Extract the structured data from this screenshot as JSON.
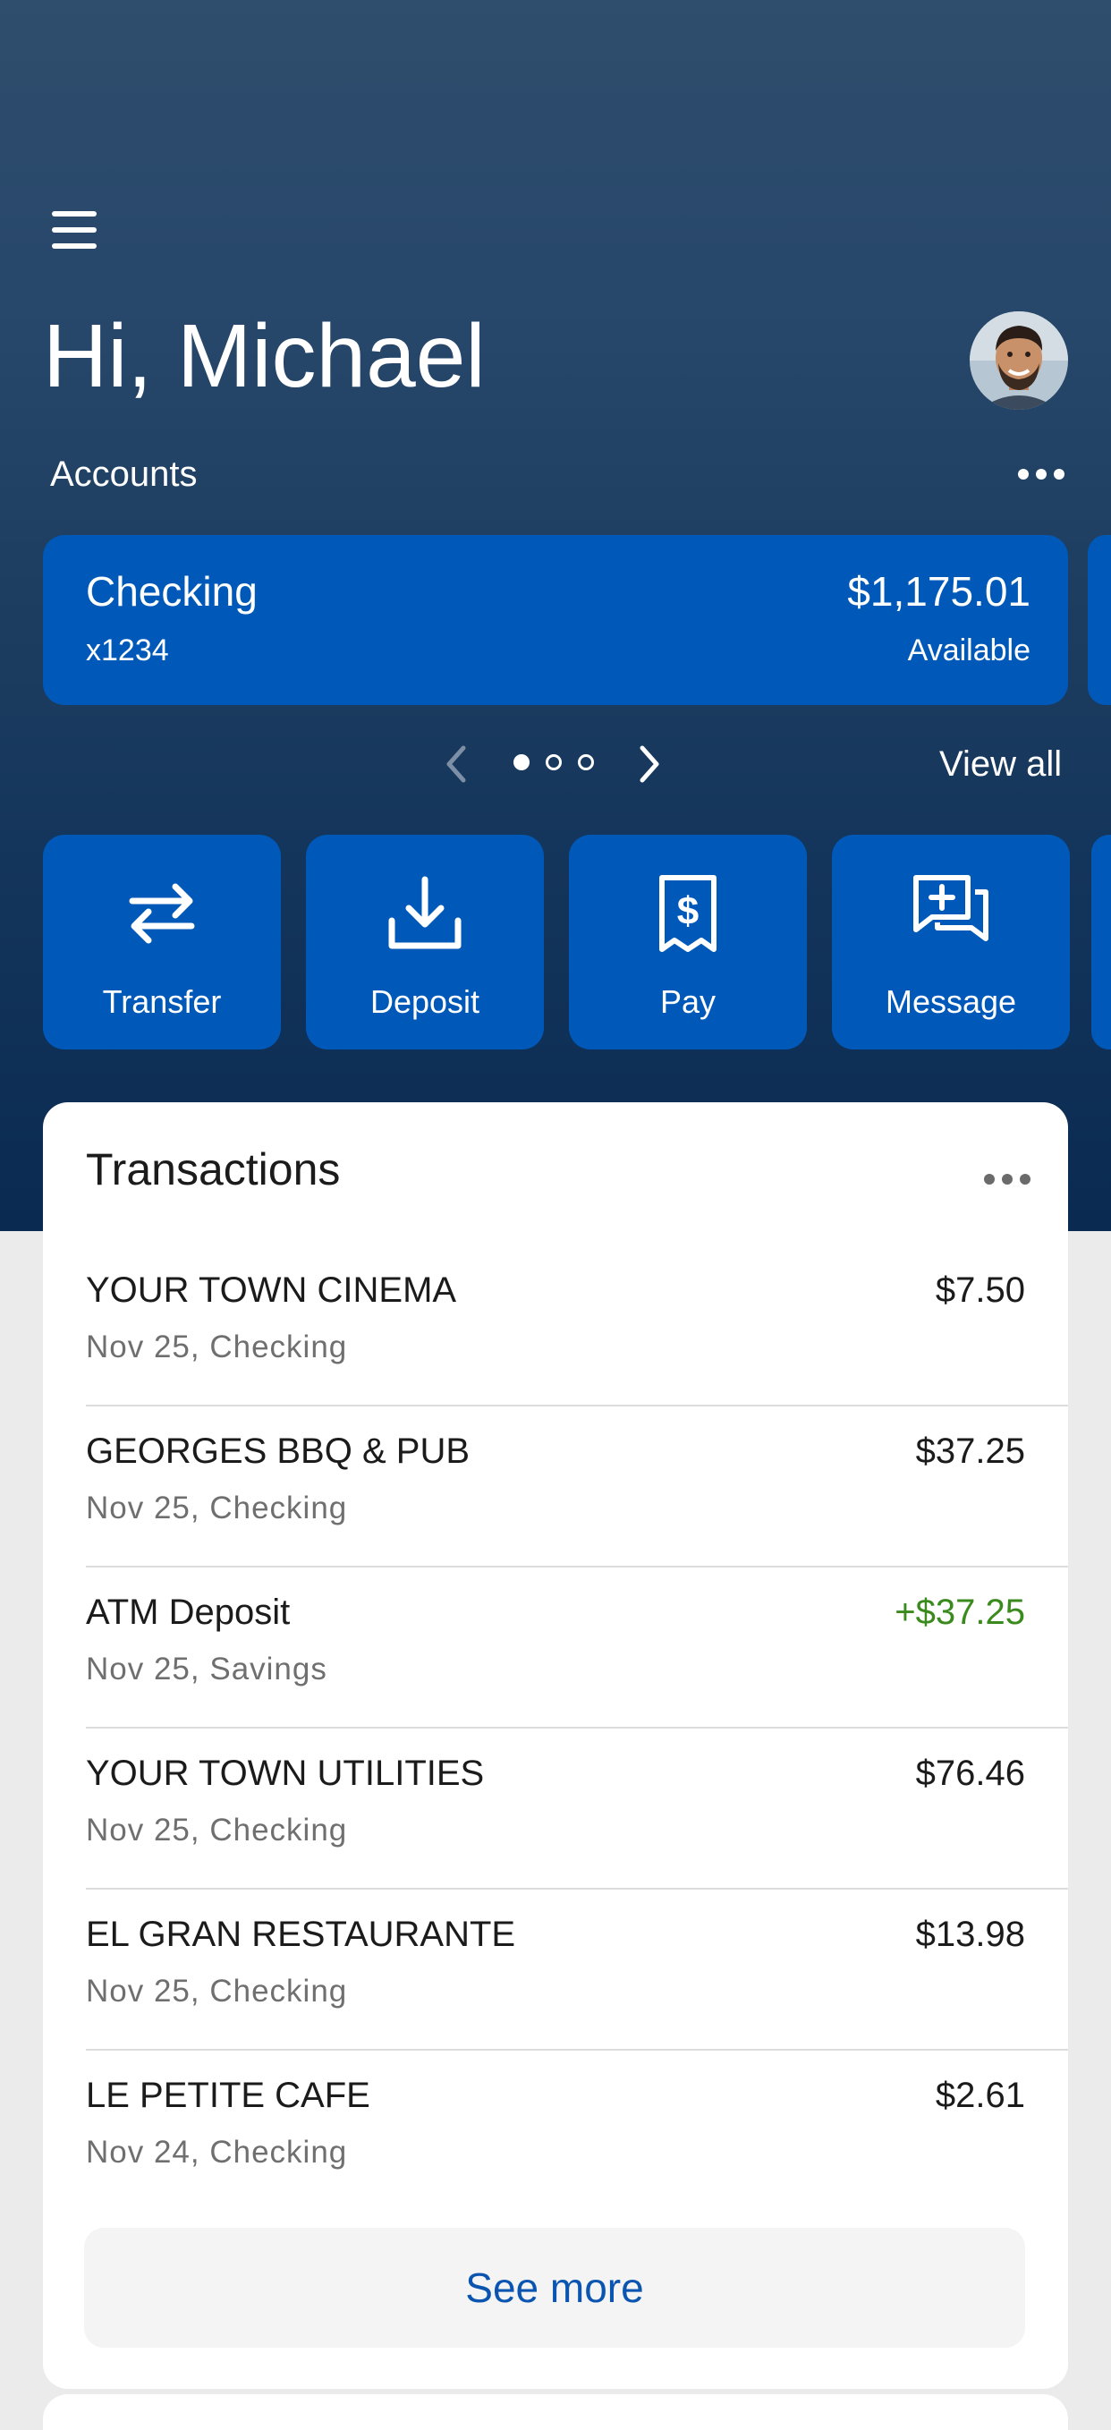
{
  "header": {
    "greeting": "Hi, Michael",
    "accounts_label": "Accounts"
  },
  "account": {
    "name": "Checking",
    "number": "x1234",
    "balance": "$1,175.01",
    "balance_label": "Available"
  },
  "carousel": {
    "page_count": 3,
    "active_page": 1,
    "view_all_label": "View all"
  },
  "actions": [
    {
      "label": "Transfer",
      "icon": "transfer-icon"
    },
    {
      "label": "Deposit",
      "icon": "deposit-icon"
    },
    {
      "label": "Pay",
      "icon": "pay-bill-icon"
    },
    {
      "label": "Message",
      "icon": "message-icon"
    }
  ],
  "transactions": {
    "title": "Transactions",
    "items": [
      {
        "name": "YOUR TOWN CINEMA",
        "detail": "Nov 25, Checking",
        "amount": "$7.50"
      },
      {
        "name": "GEORGES BBQ & PUB",
        "detail": "Nov 25, Checking",
        "amount": "$37.25"
      },
      {
        "name": "ATM Deposit",
        "detail": "Nov 25, Savings",
        "amount": "+$37.25"
      },
      {
        "name": "YOUR TOWN UTILITIES",
        "detail": "Nov 25, Checking",
        "amount": "$76.46"
      },
      {
        "name": "EL GRAN RESTAURANTE",
        "detail": "Nov 25, Checking",
        "amount": "$13.98"
      },
      {
        "name": "LE PETITE CAFE",
        "detail": "Nov 24, Checking",
        "amount": "$2.61"
      }
    ],
    "see_more_label": "See more"
  },
  "colors": {
    "accent_blue": "#0059b8",
    "link_blue": "#0b55b0",
    "positive_green": "#3a8a1e"
  }
}
